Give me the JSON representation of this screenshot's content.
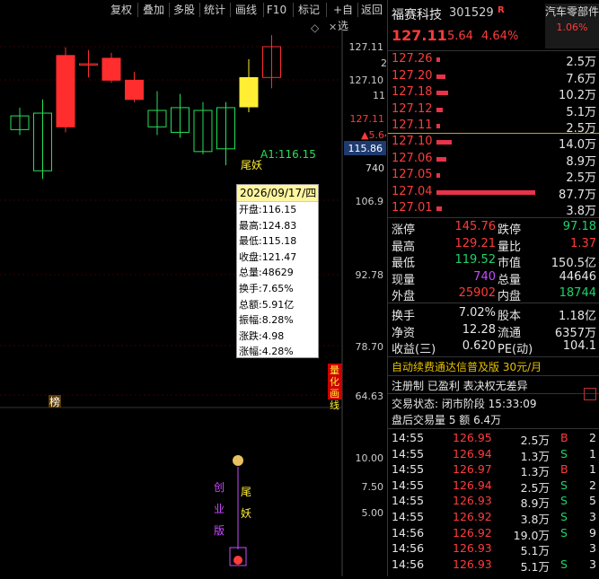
{
  "toolbar": {
    "buttons": [
      "复权",
      "叠加",
      "多股",
      "统计",
      "画线",
      "F10",
      "标记",
      "+自选",
      "返回"
    ]
  },
  "chart": {
    "y_labels": [
      "127.11",
      "2",
      "127.10",
      "11",
      "106.9",
      "92.78",
      "78.70",
      "64.63"
    ],
    "right_price_labels": {
      "p127_11": "127.11",
      "arrow_564": "▲5.64",
      "box_11586": "115.86",
      "v740": "740"
    },
    "annotations": {
      "a1": "A1:116.15",
      "weiyao": "尾妖",
      "bang": "榜",
      "quant_btn": "量化画线"
    },
    "candles": [
      {
        "open": 112.0,
        "close": 114.5,
        "high": 116.0,
        "low": 111.0
      },
      {
        "open": 115.0,
        "close": 104.5,
        "high": 117.5,
        "low": 103.0
      },
      {
        "open": 112.5,
        "close": 125.5,
        "high": 127.0,
        "low": 111.5
      },
      {
        "open": 124.0,
        "close": 124.0,
        "high": 126.5,
        "low": 121.5
      },
      {
        "open": 125.0,
        "close": 121.0,
        "high": 126.0,
        "low": 120.5
      },
      {
        "open": 121.0,
        "close": 117.5,
        "high": 122.5,
        "low": 117.0
      },
      {
        "open": 115.5,
        "close": 112.5,
        "high": 119.0,
        "low": 111.0
      },
      {
        "open": 111.5,
        "close": 116.0,
        "high": 118.5,
        "low": 110.5
      },
      {
        "open": 108.0,
        "close": 115.5,
        "high": 117.0,
        "low": 107.5
      },
      {
        "open": 108.5,
        "close": 116.0,
        "high": 117.0,
        "low": 105.5
      },
      {
        "open": 116.15,
        "close": 121.47,
        "high": 124.83,
        "low": 115.18
      },
      {
        "open": 121.5,
        "close": 127.11,
        "high": 129.21,
        "low": 119.52
      }
    ],
    "lower_labels": [
      "10.00",
      "7.50",
      "5.00"
    ],
    "lower_text": {
      "left": "创业版",
      "right": "尾妖"
    }
  },
  "infobox": {
    "date": "2026/09/17/四",
    "items": [
      "开盘:116.15",
      "最高:124.83",
      "最低:115.18",
      "收盘:121.47",
      "总量:48629",
      "换手:7.65%",
      "总额:5.91亿",
      "振幅:8.28%",
      "涨跌:4.98",
      "涨幅:4.28%"
    ]
  },
  "quote": {
    "name": "福赛科技",
    "code": "301529",
    "badge": "R",
    "sector": "汽车零部件",
    "sector_pct": "1.06%",
    "price": "127.11",
    "change": "5.64",
    "pct": "4.64%"
  },
  "asks": [
    {
      "price": "127.26",
      "vol": "2.5万",
      "bar": 0.04
    },
    {
      "price": "127.20",
      "vol": "7.6万",
      "bar": 0.09
    },
    {
      "price": "127.18",
      "vol": "10.2万",
      "bar": 0.12
    },
    {
      "price": "127.12",
      "vol": "5.1万",
      "bar": 0.06
    },
    {
      "price": "127.11",
      "vol": "2.5万",
      "bar": 0.04
    }
  ],
  "bids": [
    {
      "price": "127.10",
      "vol": "14.0万",
      "bar": 0.15
    },
    {
      "price": "127.06",
      "vol": "8.9万",
      "bar": 0.1
    },
    {
      "price": "127.05",
      "vol": "2.5万",
      "bar": 0.04
    },
    {
      "price": "127.04",
      "vol": "87.7万",
      "bar": 1.0
    },
    {
      "price": "127.01",
      "vol": "3.8万",
      "bar": 0.05
    }
  ],
  "stats": [
    {
      "l1": "涨停",
      "v1": "145.76",
      "c1": "red",
      "l2": "跌停",
      "v2": "97.18",
      "c2": "green"
    },
    {
      "l1": "最高",
      "v1": "129.21",
      "c1": "red",
      "l2": "量比",
      "v2": "1.37",
      "c2": "red"
    },
    {
      "l1": "最低",
      "v1": "119.52",
      "c1": "green",
      "l2": "市值",
      "v2": "150.5亿",
      "c2": "white"
    },
    {
      "l1": "现量",
      "v1": "740",
      "c1": "purple",
      "l2": "总量",
      "v2": "44646",
      "c2": "white"
    },
    {
      "l1": "外盘",
      "v1": "25902",
      "c1": "red",
      "l2": "内盘",
      "v2": "18744",
      "c2": "green"
    }
  ],
  "stats2": [
    {
      "l1": "换手",
      "v1": "7.02%",
      "l2": "股本",
      "v2": "1.18亿"
    },
    {
      "l1": "净资",
      "v1": "12.28",
      "l2": "流通",
      "v2": "6357万"
    },
    {
      "l1": "收益(三)",
      "v1": "0.620",
      "l2": "PE(动)",
      "v2": "104.1"
    }
  ],
  "promo": "自动续费通达信普及版  30元/月",
  "tags": "注册制 已盈利 表决权无差异",
  "status": "交易状态: 闭市阶段 15:33:09",
  "after_hours": "盘后交易量 5 额 6.4万",
  "ticks": [
    {
      "t": "14:55",
      "p": "126.95",
      "v": "2.5万",
      "bs": "B",
      "n": "2"
    },
    {
      "t": "14:55",
      "p": "126.94",
      "v": "1.3万",
      "bs": "S",
      "n": "1"
    },
    {
      "t": "14:55",
      "p": "126.97",
      "v": "1.3万",
      "bs": "B",
      "n": "1"
    },
    {
      "t": "14:55",
      "p": "126.94",
      "v": "2.5万",
      "bs": "S",
      "n": "2"
    },
    {
      "t": "14:55",
      "p": "126.93",
      "v": "8.9万",
      "bs": "S",
      "n": "5"
    },
    {
      "t": "14:55",
      "p": "126.92",
      "v": "3.8万",
      "bs": "S",
      "n": "3"
    },
    {
      "t": "14:56",
      "p": "126.92",
      "v": "19.0万",
      "bs": "S",
      "n": "9"
    },
    {
      "t": "14:56",
      "p": "126.93",
      "v": "5.1万",
      "bs": "",
      "n": "3"
    },
    {
      "t": "14:56",
      "p": "126.93",
      "v": "5.1万",
      "bs": "S",
      "n": "3"
    }
  ]
}
